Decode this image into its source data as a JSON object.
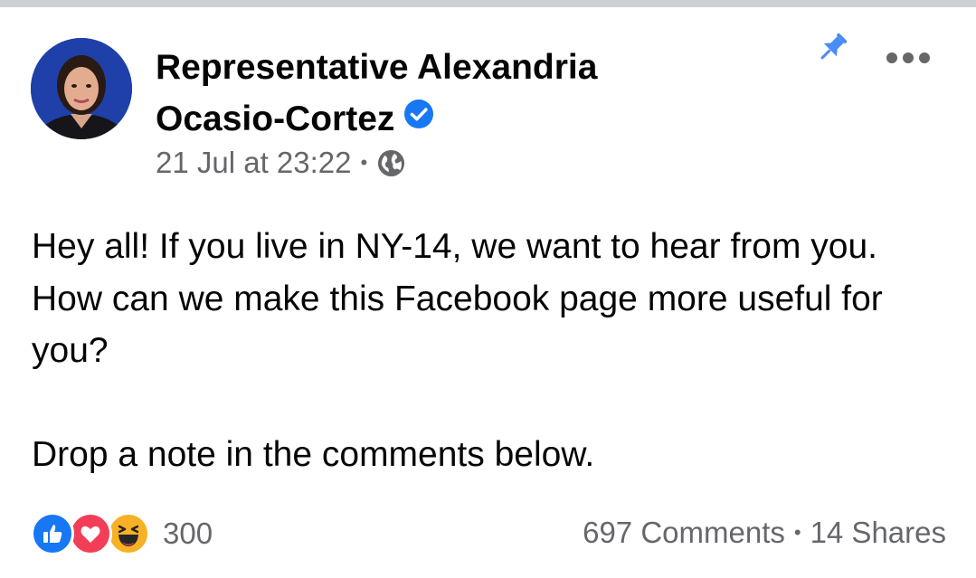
{
  "post": {
    "author": {
      "name_line1": "Representative Alexandria",
      "name_line2": "Ocasio-Cortez",
      "verified": true
    },
    "timestamp": "21 Jul at 23:22",
    "separator": "•",
    "privacy_icon": "globe-icon",
    "body": {
      "line_block_1": "Hey all! If you live in NY-14, we want to hear from you. How can we make this Facebook page more useful for you?",
      "line_block_2": "Drop a note in the comments below."
    },
    "reactions": {
      "types": [
        "like-icon",
        "love-icon",
        "haha-icon"
      ],
      "count": "300"
    },
    "comments_label": "697 Comments",
    "shares_label": "14 Shares"
  },
  "colors": {
    "accent_blue": "#1877f2",
    "secondary_text": "#65676b",
    "love_red": "#f33e58",
    "haha_yellow": "#f7b125",
    "pin_blue": "#4a8cf7"
  }
}
